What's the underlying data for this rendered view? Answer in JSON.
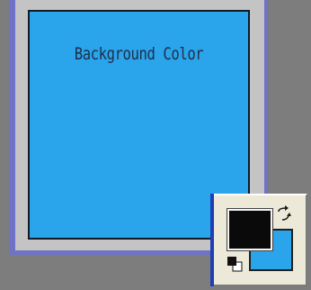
{
  "canvas": {
    "label": "Background Color",
    "background_color": "#2aa4ea"
  },
  "color_picker": {
    "foreground_color": "#0a0a0a",
    "background_color": "#2aa4ea",
    "icons": {
      "swap": "swap-colors-icon",
      "default": "default-colors-icon"
    }
  }
}
